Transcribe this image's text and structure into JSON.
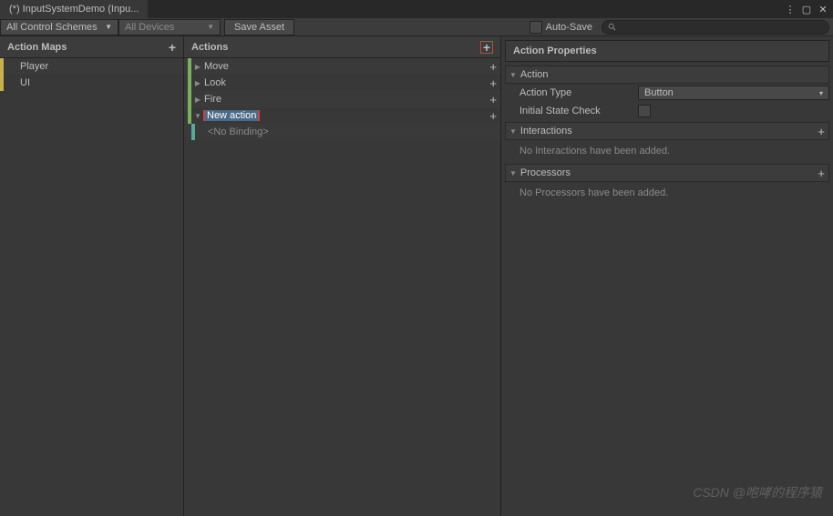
{
  "tab": {
    "title": "(*) InputSystemDemo (Inpu..."
  },
  "toolbar": {
    "schemes": "All Control Schemes",
    "devices": "All Devices",
    "save": "Save Asset",
    "autosave": "Auto-Save"
  },
  "panels": {
    "maps_title": "Action Maps",
    "actions_title": "Actions",
    "props_title": "Action Properties"
  },
  "maps": [
    {
      "label": "Player"
    },
    {
      "label": "UI"
    }
  ],
  "actions": [
    {
      "label": "Move",
      "expanded": false
    },
    {
      "label": "Look",
      "expanded": false
    },
    {
      "label": "Fire",
      "expanded": false
    },
    {
      "label": "New action",
      "expanded": true,
      "editing": true,
      "bindings": [
        {
          "label": "<No Binding>"
        }
      ]
    }
  ],
  "props": {
    "action_section": "Action",
    "action_type_label": "Action Type",
    "action_type_value": "Button",
    "initial_check_label": "Initial State Check",
    "interactions_section": "Interactions",
    "interactions_empty": "No Interactions have been added.",
    "processors_section": "Processors",
    "processors_empty": "No Processors have been added."
  },
  "watermark": "CSDN @咆哮的程序猿"
}
